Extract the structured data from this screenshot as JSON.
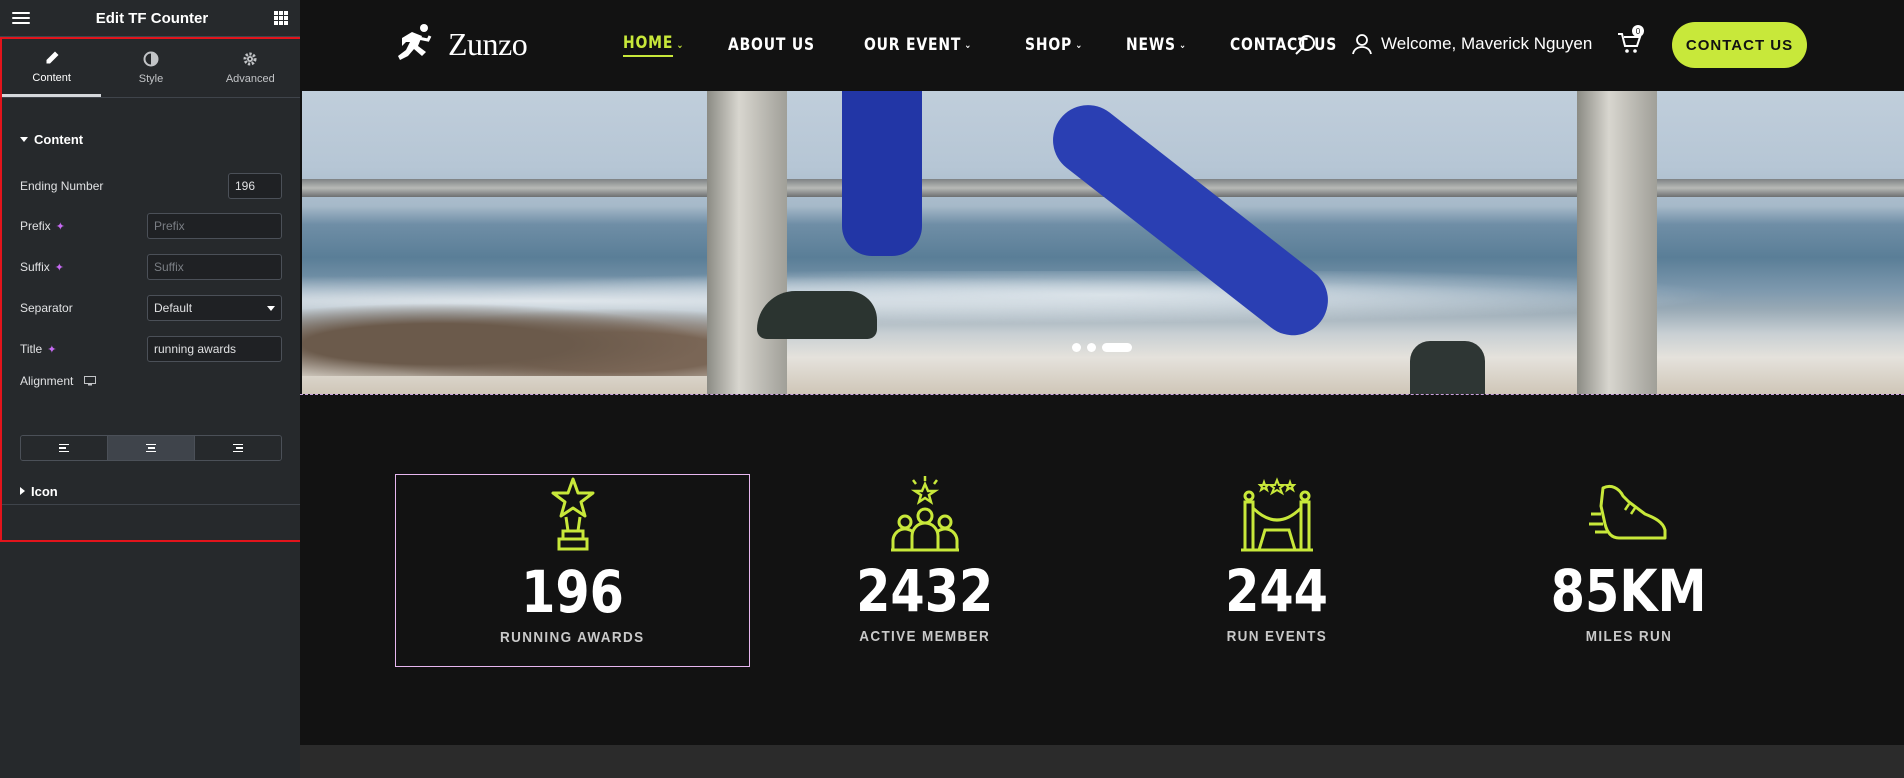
{
  "editor": {
    "title": "Edit TF Counter",
    "tabs": [
      {
        "label": "Content",
        "icon": "pencil-icon",
        "active": true
      },
      {
        "label": "Style",
        "icon": "half-circle-icon",
        "active": false
      },
      {
        "label": "Advanced",
        "icon": "gear-icon",
        "active": false
      }
    ],
    "section_content": "Content",
    "fields": {
      "ending_number": {
        "label": "Ending Number",
        "value": "196"
      },
      "prefix": {
        "label": "Prefix",
        "placeholder": "Prefix",
        "value": ""
      },
      "suffix": {
        "label": "Suffix",
        "placeholder": "Suffix",
        "value": ""
      },
      "separator": {
        "label": "Separator",
        "value": "Default"
      },
      "title": {
        "label": "Title",
        "value": "running awards"
      },
      "alignment": {
        "label": "Alignment",
        "selected": "center",
        "options": [
          "left",
          "center",
          "right"
        ]
      }
    },
    "section_icon": "Icon"
  },
  "site": {
    "brand": "Zunzo",
    "nav": [
      {
        "label": "HOME",
        "active": true,
        "dropdown": true
      },
      {
        "label": "ABOUT US",
        "active": false,
        "dropdown": false
      },
      {
        "label": "OUR EVENT",
        "active": false,
        "dropdown": true
      },
      {
        "label": "SHOP",
        "active": false,
        "dropdown": true
      },
      {
        "label": "NEWS",
        "active": false,
        "dropdown": true
      },
      {
        "label": "CONTACT US",
        "active": false,
        "dropdown": false
      }
    ],
    "welcome": "Welcome, Maverick Nguyen",
    "cart_count": "0",
    "cta": "CONTACT US",
    "accent": "#c8e83a",
    "slider_dots": 3,
    "active_dot": 2,
    "stats": [
      {
        "number": "196",
        "label": "RUNNING AWARDS",
        "icon": "trophy-star-icon",
        "selected": true
      },
      {
        "number": "2432",
        "label": "ACTIVE MEMBER",
        "icon": "group-star-icon",
        "selected": false
      },
      {
        "number": "244",
        "label": "RUN EVENTS",
        "icon": "event-stage-icon",
        "selected": false
      },
      {
        "number": "85KM",
        "label": "MILES RUN",
        "icon": "running-shoe-icon",
        "selected": false
      }
    ]
  }
}
